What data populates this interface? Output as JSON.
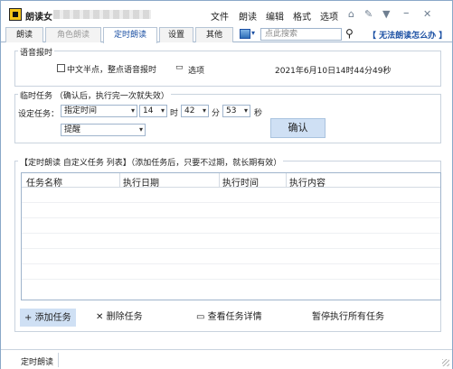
{
  "app": {
    "title": "朗读女"
  },
  "menu": [
    "文件",
    "朗读",
    "编辑",
    "格式",
    "选项"
  ],
  "title_icons": [
    "home-icon",
    "pin-icon",
    "shirt-icon",
    "minimize-icon",
    "close-icon"
  ],
  "tabs": [
    {
      "label": "朗读",
      "state": "normal"
    },
    {
      "label": "角色朗读",
      "state": "disabled"
    },
    {
      "label": "定时朗读",
      "state": "active"
    },
    {
      "label": "设置",
      "state": "normal"
    },
    {
      "label": "其他",
      "state": "normal"
    }
  ],
  "search": {
    "placeholder": "点此搜索"
  },
  "help_link": "【 无法朗读怎么办 】",
  "voice_report": {
    "title": "语音报时",
    "checkbox_label": "中文半点，整点语音报时",
    "checkbox_checked": false,
    "options_label": "选项",
    "datetime": "2021年6月10日14时44分49秒"
  },
  "temp_task": {
    "title": "临时任务 （确认后，执行完一次就失效）",
    "setting_label": "设定任务：",
    "task_type": "指定时间",
    "hour": "14",
    "hour_unit": "时",
    "minute": "42",
    "minute_unit": "分",
    "second": "53",
    "second_unit": "秒",
    "action": "提醒",
    "confirm_label": "确认"
  },
  "timed_tasks": {
    "title": "【定时朗读  自定义任务 列表】（添加任务后，只要不过期，就长期有效）",
    "columns": [
      "任务名称",
      "执行日期",
      "执行时间",
      "执行内容"
    ],
    "rows": []
  },
  "actions": {
    "add": "添加任务",
    "delete": "删除任务",
    "view": "查看任务详情",
    "pause_all": "暂停执行所有任务"
  },
  "status": {
    "text": "定时朗读"
  },
  "colors": {
    "accent": "#1a4fa3",
    "button_bg": "#cfe0f4",
    "border": "#9fb4cc"
  }
}
